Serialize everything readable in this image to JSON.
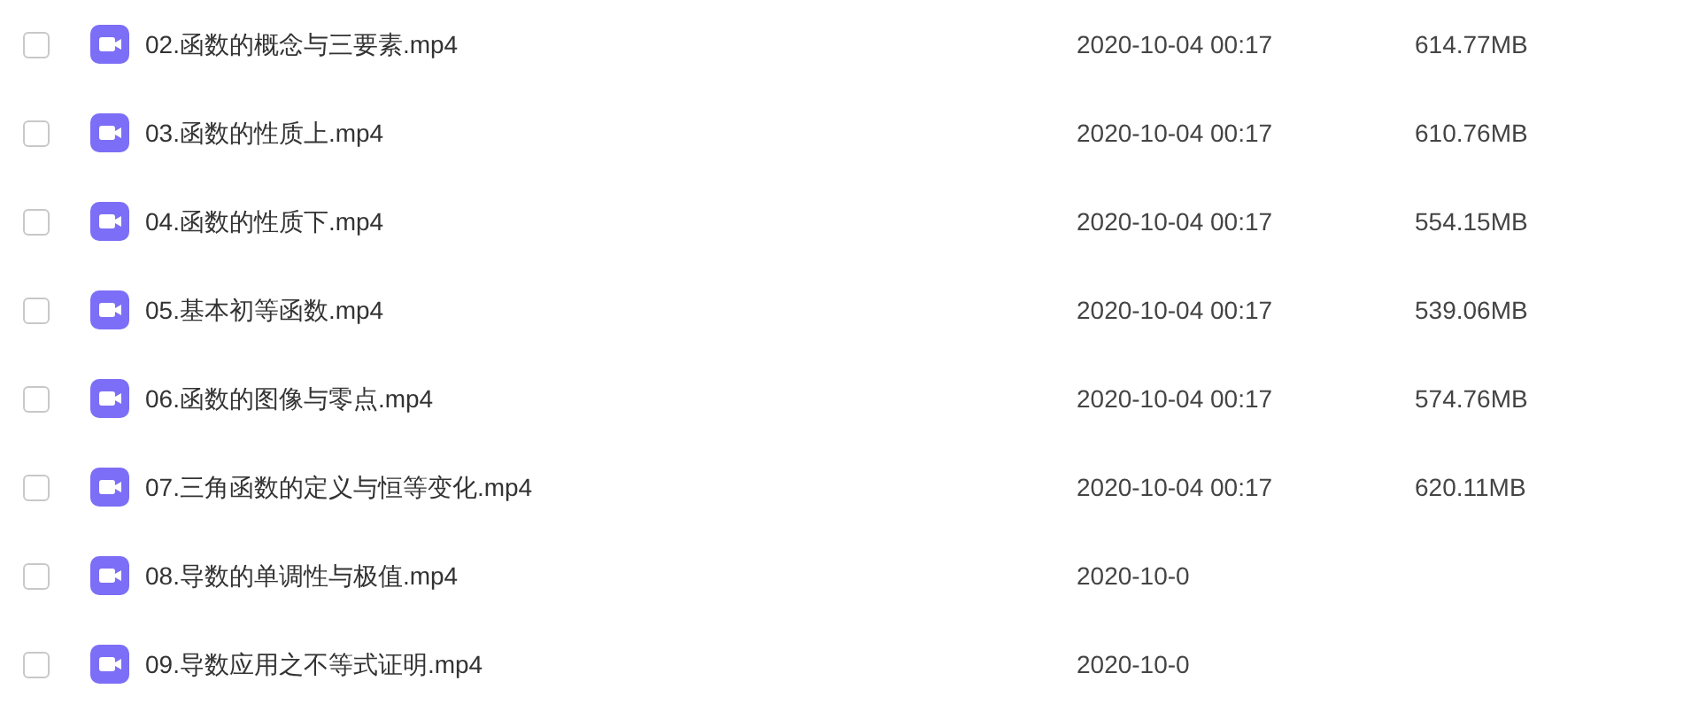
{
  "files": [
    {
      "name": "02.函数的概念与三要素.mp4",
      "date": "2020-10-04 00:17",
      "size": "614.77MB",
      "checked": false
    },
    {
      "name": "03.函数的性质上.mp4",
      "date": "2020-10-04 00:17",
      "size": "610.76MB",
      "checked": false
    },
    {
      "name": "04.函数的性质下.mp4",
      "date": "2020-10-04 00:17",
      "size": "554.15MB",
      "checked": false
    },
    {
      "name": "05.基本初等函数.mp4",
      "date": "2020-10-04 00:17",
      "size": "539.06MB",
      "checked": false
    },
    {
      "name": "06.函数的图像与零点.mp4",
      "date": "2020-10-04 00:17",
      "size": "574.76MB",
      "checked": false
    },
    {
      "name": "07.三角函数的定义与恒等变化.mp4",
      "date": "2020-10-04 00:17",
      "size": "620.11MB",
      "checked": false
    },
    {
      "name": "08.导数的单调性与极值.mp4",
      "date": "2020-10-0",
      "checked": false
    },
    {
      "name": "09.导数应用之不等式证明.mp4",
      "date": "2020-10-0",
      "checked": false
    }
  ]
}
